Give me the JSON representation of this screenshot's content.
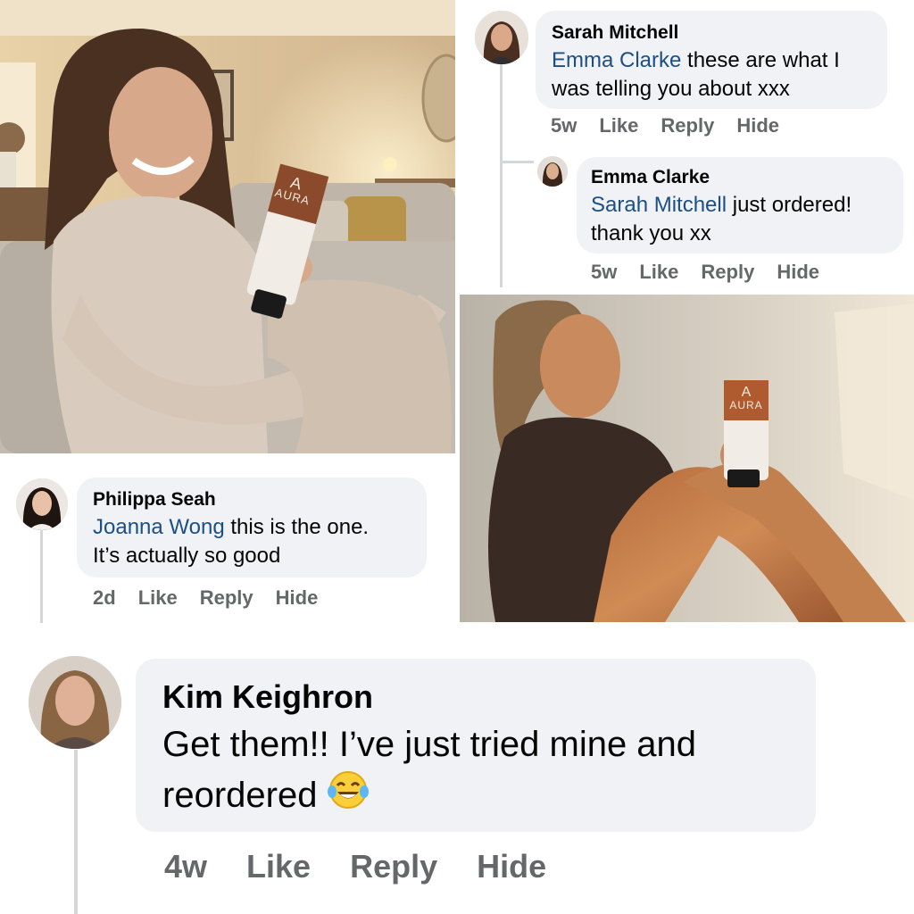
{
  "comments": [
    {
      "author": "Sarah Mitchell",
      "mention": "Emma Clarke",
      "text_line1": " these are what I",
      "text_line2": "was telling you about xxx",
      "time": "5w",
      "like": "Like",
      "reply": "Reply",
      "hide": "Hide"
    },
    {
      "author": "Emma Clarke",
      "mention": "Sarah Mitchell",
      "text_line1": " just ordered!",
      "text_line2": "thank you xx",
      "time": "5w",
      "like": "Like",
      "reply": "Reply",
      "hide": "Hide"
    },
    {
      "author": "Philippa Seah",
      "mention": "Joanna Wong",
      "text_line1": " this is the one.",
      "text_line2": "It’s actually so good",
      "time": "2d",
      "like": "Like",
      "reply": "Reply",
      "hide": "Hide"
    },
    {
      "author": "Kim Keighron",
      "text_line1": "Get them!! I’ve just tried mine and",
      "text_line2": "reordered ",
      "emoji": "face-with-tears-of-joy-icon",
      "time": "4w",
      "like": "Like",
      "reply": "Reply",
      "hide": "Hide"
    }
  ],
  "product": {
    "brand_letter": "A",
    "brand": "AURA"
  },
  "colors": {
    "bubble": "#f0f2f5",
    "mention": "#1b4f86",
    "meta": "#65676b",
    "thread_line": "#d4d6da"
  }
}
